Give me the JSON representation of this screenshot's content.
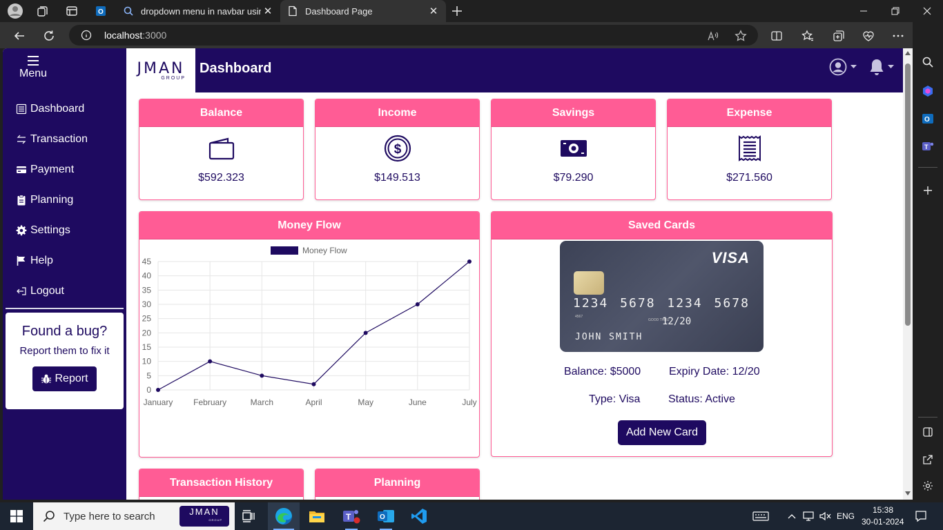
{
  "browser": {
    "tabs": [
      {
        "title": "dropdown menu in navbar using",
        "active": false
      },
      {
        "title": "Dashboard Page",
        "active": true
      }
    ],
    "url_host": "localhost",
    "url_port": ":3000"
  },
  "sidebar": {
    "menu_label": "Menu",
    "items": [
      {
        "label": "Dashboard",
        "icon": "newspaper-icon"
      },
      {
        "label": "Transaction",
        "icon": "arrows-swap-icon"
      },
      {
        "label": "Payment",
        "icon": "credit-card-icon"
      },
      {
        "label": "Planning",
        "icon": "clipboard-icon"
      },
      {
        "label": "Settings",
        "icon": "gear-icon"
      },
      {
        "label": "Help",
        "icon": "flag-icon"
      },
      {
        "label": "Logout",
        "icon": "logout-icon"
      }
    ],
    "bug_card": {
      "title": "Found a bug?",
      "subtitle": "Report them to fix it",
      "button_label": "Report"
    }
  },
  "header": {
    "logo_main": "JMAN",
    "logo_sub": "GROUP",
    "title": "Dashboard"
  },
  "stats": [
    {
      "label": "Balance",
      "value": "$592.323",
      "icon": "wallet-icon"
    },
    {
      "label": "Income",
      "value": "$149.513",
      "icon": "dollar-circle-icon"
    },
    {
      "label": "Savings",
      "value": "$79.290",
      "icon": "cash-icon"
    },
    {
      "label": "Expense",
      "value": "$271.560",
      "icon": "receipt-icon"
    }
  ],
  "money_flow": {
    "title": "Money Flow"
  },
  "chart_data": {
    "type": "line",
    "categories": [
      "January",
      "February",
      "March",
      "April",
      "May",
      "June",
      "July"
    ],
    "series": [
      {
        "name": "Money Flow",
        "values": [
          0,
          10,
          5,
          2,
          20,
          30,
          45
        ],
        "color": "#1e0a60"
      }
    ],
    "title": "",
    "xlabel": "",
    "ylabel": "",
    "ylim": [
      0,
      45
    ],
    "yticks": [
      0,
      5,
      10,
      15,
      20,
      25,
      30,
      35,
      40,
      45
    ],
    "grid": true,
    "legend": "top"
  },
  "saved_cards": {
    "title": "Saved Cards",
    "card": {
      "brand": "VISA",
      "number": "1234 5678 1234 5678",
      "small_code": "4567",
      "valid_label": "GOOD THRU",
      "expiry": "12/20",
      "holder": "JOHN SMITH"
    },
    "balance": "Balance: $5000",
    "expiry_date": "Expiry Date: 12/20",
    "type": "Type: Visa",
    "status": "Status: Active",
    "add_button": "Add New Card"
  },
  "bottom_cards": [
    {
      "label": "Transaction History"
    },
    {
      "label": "Planning"
    }
  ],
  "taskbar": {
    "search_placeholder": "Type here to search",
    "logo_main": "JMAN",
    "logo_sub": "GROUP",
    "language": "ENG",
    "time": "15:38",
    "date": "30-01-2024"
  },
  "colors": {
    "primary": "#1e0a60",
    "accent": "#ff5c95"
  }
}
